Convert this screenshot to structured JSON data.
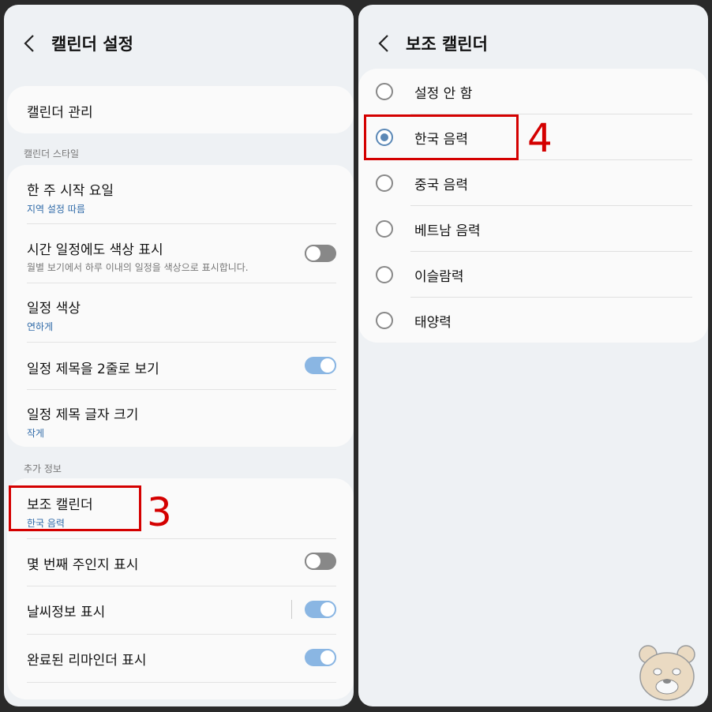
{
  "left": {
    "title": "캘린더 설정",
    "manage": "캘린더 관리",
    "section_style": "캘린더 스타일",
    "style_items": [
      {
        "title": "한 주 시작 요일",
        "sub": "지역 설정 따름"
      },
      {
        "title": "시간 일정에도 색상 표시",
        "desc": "월별 보기에서 하루 이내의 일정을 색상으로 표시합니다.",
        "toggle": "off"
      },
      {
        "title": "일정 색상",
        "sub": "연하게"
      },
      {
        "title": "일정 제목을 2줄로 보기",
        "toggle": "on"
      },
      {
        "title": "일정 제목 글자 크기",
        "sub": "작게"
      }
    ],
    "section_extra": "추가 정보",
    "extra_items": [
      {
        "title": "보조 캘린더",
        "sub": "한국 음력"
      },
      {
        "title": "몇 번째 주인지 표시",
        "toggle": "off"
      },
      {
        "title": "날씨정보 표시",
        "toggle": "on"
      },
      {
        "title": "완료된 리마인더 표시",
        "toggle": "on"
      }
    ],
    "annotation": "3"
  },
  "right": {
    "title": "보조 캘린더",
    "options": [
      "설정 안 함",
      "한국 음력",
      "중국 음력",
      "베트남 음력",
      "이슬람력",
      "태양력"
    ],
    "selected_index": 1,
    "annotation": "4"
  },
  "colors": {
    "accent": "#2f6aa8",
    "highlight": "#d40000",
    "toggle_on": "#8ab6e3",
    "toggle_off": "#888888"
  }
}
